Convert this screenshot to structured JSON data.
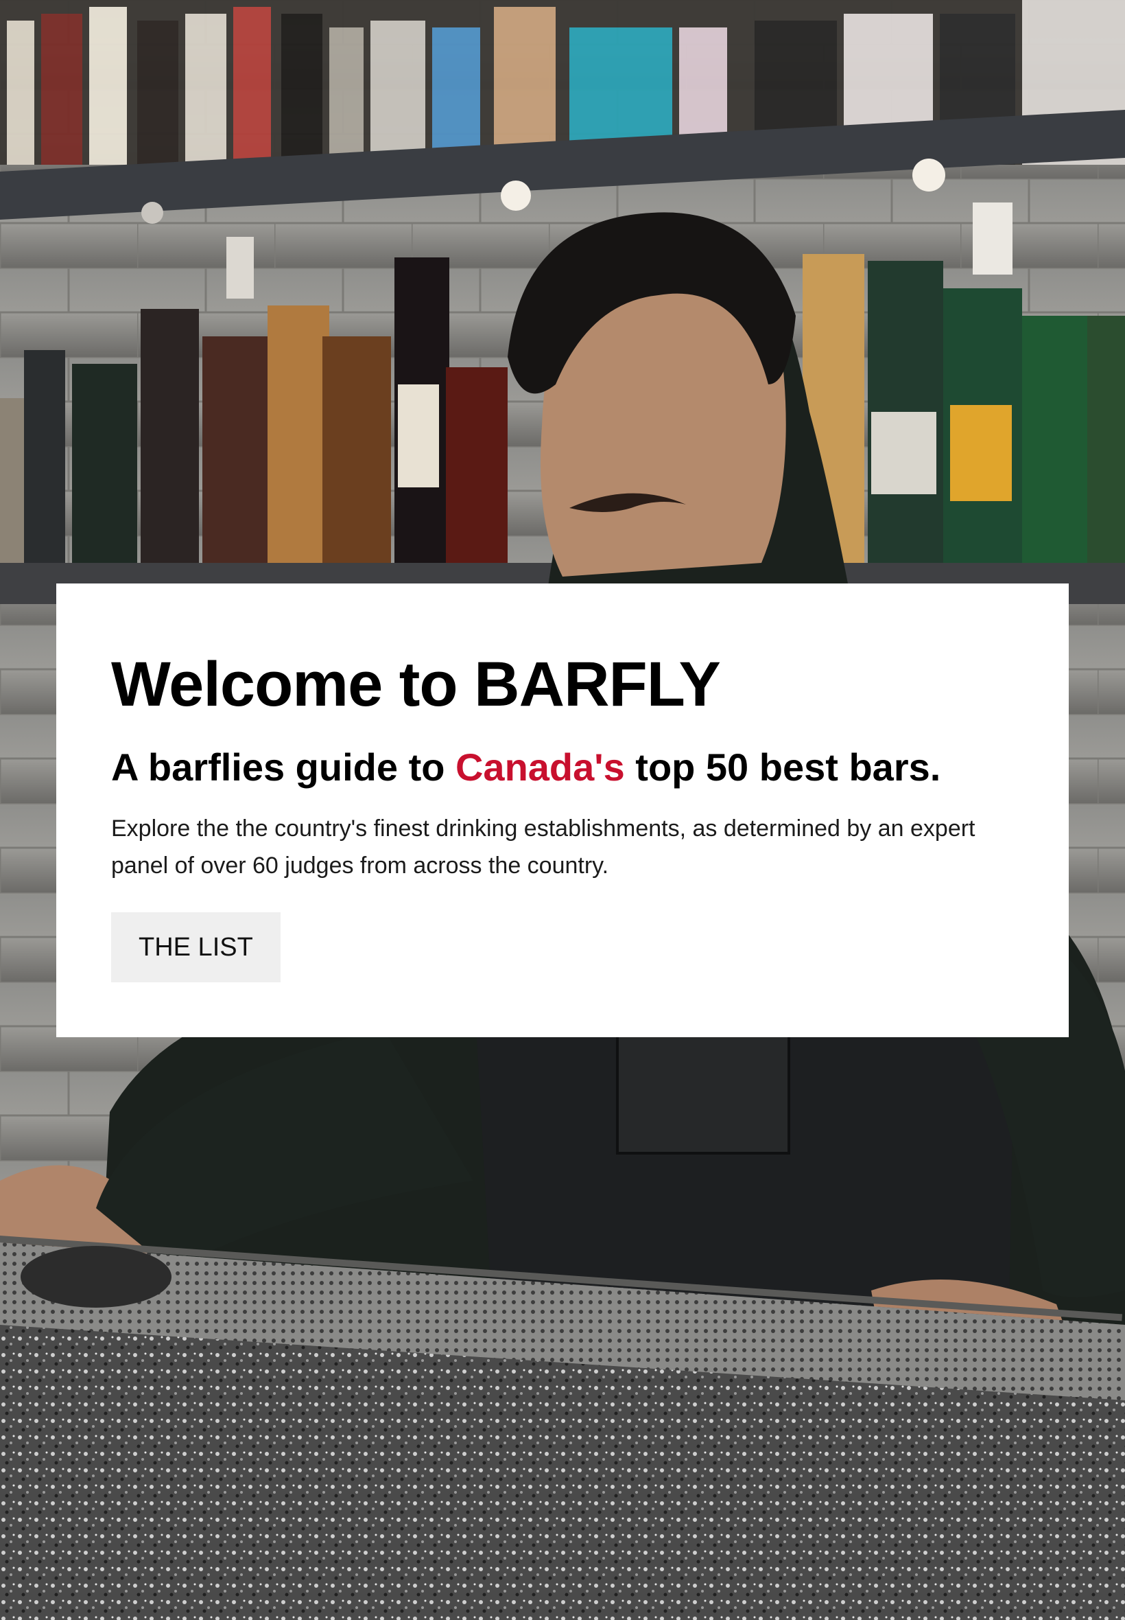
{
  "hero": {
    "image_alt": "Bartender standing behind a granite bar counter with shelves of liquor bottles"
  },
  "card": {
    "title": "Welcome to BARFLY",
    "subtitle_before": "A barflies guide to ",
    "subtitle_accent": "Canada's",
    "subtitle_after": " top 50 best bars.",
    "description": "Explore the the country's finest drinking establishments, as determined by an expert panel of over 60 judges from across the country.",
    "cta_label": "THE LIST"
  },
  "colors": {
    "accent": "#c8102e",
    "card_bg": "#ffffff",
    "button_bg": "#efefef",
    "text": "#000000"
  }
}
